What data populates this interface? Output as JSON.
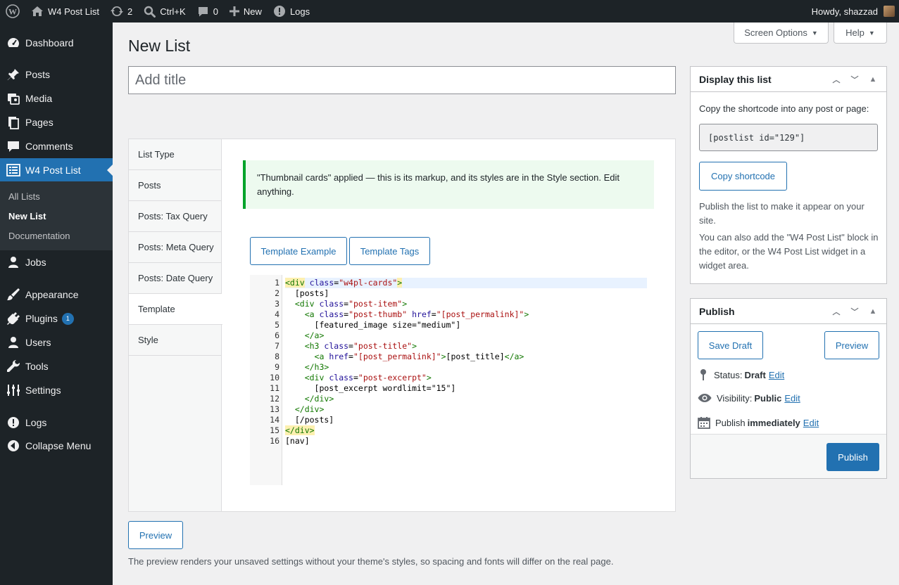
{
  "adminbar": {
    "site_name": "W4 Post List",
    "updates_count": "2",
    "search_shortcut": "Ctrl+K",
    "comments_count": "0",
    "new_label": "New",
    "logs_label": "Logs",
    "howdy": "Howdy, shazzad"
  },
  "sidebar": {
    "items": [
      {
        "label": "Dashboard",
        "icon": "dashboard-icon"
      },
      {
        "label": "Posts",
        "icon": "pin-icon"
      },
      {
        "label": "Media",
        "icon": "media-icon"
      },
      {
        "label": "Pages",
        "icon": "pages-icon"
      },
      {
        "label": "Comments",
        "icon": "comment-icon"
      },
      {
        "label": "W4 Post List",
        "icon": "list-icon"
      },
      {
        "label": "Jobs",
        "icon": "user-icon"
      },
      {
        "label": "Appearance",
        "icon": "brush-icon"
      },
      {
        "label": "Plugins",
        "icon": "plug-icon",
        "badge": "1"
      },
      {
        "label": "Users",
        "icon": "users-icon"
      },
      {
        "label": "Tools",
        "icon": "wrench-icon"
      },
      {
        "label": "Settings",
        "icon": "sliders-icon"
      },
      {
        "label": "Logs",
        "icon": "alert-icon"
      },
      {
        "label": "Collapse Menu",
        "icon": "collapse-icon"
      }
    ],
    "submenu": [
      "All Lists",
      "New List",
      "Documentation"
    ]
  },
  "header": {
    "screen_options": "Screen Options",
    "help": "Help",
    "page_title": "New List",
    "title_placeholder": "Add title"
  },
  "tabs": [
    "List Type",
    "Posts",
    "Posts: Tax Query",
    "Posts: Meta Query",
    "Posts: Date Query",
    "Template",
    "Style"
  ],
  "template_panel": {
    "notice": "\"Thumbnail cards\" applied — this is its markup, and its styles are in the Style section. Edit anything.",
    "btn_example": "Template Example",
    "btn_tags": "Template Tags",
    "line_numbers": [
      "1",
      "2",
      "3",
      "4",
      "5",
      "6",
      "7",
      "8",
      "9",
      "10",
      "11",
      "12",
      "13",
      "14",
      "15",
      "16"
    ]
  },
  "display_box": {
    "title": "Display this list",
    "intro": "Copy the shortcode into any post or page:",
    "shortcode": "[postlist id=\"129\"]",
    "copy_button": "Copy shortcode",
    "publish_note": "Publish the list to make it appear on your site.",
    "block_note": "You can also add the \"W4 Post List\" block in the editor, or the W4 Post List widget in a widget area."
  },
  "publish_box": {
    "title": "Publish",
    "save_draft": "Save Draft",
    "preview": "Preview",
    "status_label": "Status:",
    "status_value": "Draft",
    "visibility_label": "Visibility:",
    "visibility_value": "Public",
    "publish_label": "Publish",
    "publish_value": "immediately",
    "edit": "Edit",
    "publish_button": "Publish"
  },
  "footer": {
    "preview_button": "Preview",
    "preview_note": "The preview renders your unsaved settings without your theme's styles, so spacing and fonts will differ on the real page."
  },
  "colors": {
    "accent": "#2271b1",
    "sidebar_bg": "#1d2327",
    "notice_border": "#00a32a"
  }
}
